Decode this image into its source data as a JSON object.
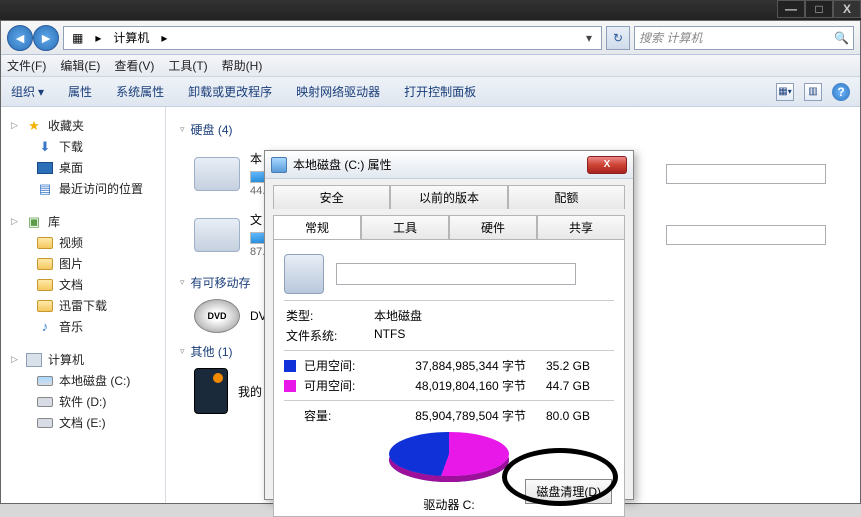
{
  "window_controls": {
    "min": "—",
    "max": "□",
    "close": "X"
  },
  "nav": {
    "back": "◄",
    "fwd": "►",
    "breadcrumb_icon": "▦",
    "breadcrumb": "计算机",
    "breadcrumb_arrow": "▸",
    "dropdown": "▾",
    "refresh": "↻",
    "search_placeholder": "搜索 计算机",
    "search_icon": "🔍"
  },
  "menubar": [
    "文件(F)",
    "编辑(E)",
    "查看(V)",
    "工具(T)",
    "帮助(H)"
  ],
  "toolbar": {
    "organize": "组织",
    "properties": "属性",
    "sys_properties": "系统属性",
    "uninstall": "卸载或更改程序",
    "map_drive": "映射网络驱动器",
    "control_panel": "打开控制面板",
    "help": "?"
  },
  "sidebar": {
    "favorites": {
      "label": "收藏夹",
      "items": [
        "下载",
        "桌面",
        "最近访问的位置"
      ]
    },
    "libraries": {
      "label": "库",
      "items": [
        "视频",
        "图片",
        "文档",
        "迅雷下载",
        "音乐"
      ]
    },
    "computer": {
      "label": "计算机",
      "items": [
        "本地磁盘 (C:)",
        "软件 (D:)",
        "文档 (E:)"
      ]
    }
  },
  "content": {
    "hdd_section": "硬盘 (4)",
    "removable_section": "有可移动存",
    "other_section": "其他 (1)",
    "drive1": {
      "name": "本",
      "sub": "44."
    },
    "drive2": {
      "name": "文",
      "sub": "87."
    },
    "dvd": "DV",
    "phone": "我的"
  },
  "dialog": {
    "title": "本地磁盘 (C:) 属性",
    "close": "X",
    "tabs_top": [
      "安全",
      "以前的版本",
      "配额"
    ],
    "tabs_bottom": [
      "常规",
      "工具",
      "硬件",
      "共享"
    ],
    "type_k": "类型:",
    "type_v": "本地磁盘",
    "fs_k": "文件系统:",
    "fs_v": "NTFS",
    "used_label": "已用空间:",
    "used_bytes": "37,884,985,344 字节",
    "used_gb": "35.2 GB",
    "free_label": "可用空间:",
    "free_bytes": "48,019,804,160 字节",
    "free_gb": "44.7 GB",
    "cap_label": "容量:",
    "cap_bytes": "85,904,789,504 字节",
    "cap_gb": "80.0 GB",
    "drive_label": "驱动器 C:",
    "cleanup": "磁盘清理(D)"
  },
  "chart_data": {
    "type": "pie",
    "title": "驱动器 C:",
    "series": [
      {
        "name": "已用空间",
        "value": 35.2,
        "unit": "GB",
        "bytes": 37884985344,
        "color": "#1030d8"
      },
      {
        "name": "可用空间",
        "value": 44.7,
        "unit": "GB",
        "bytes": 48019804160,
        "color": "#e818e8"
      }
    ],
    "total": {
      "label": "容量",
      "value": 80.0,
      "unit": "GB",
      "bytes": 85904789504
    }
  }
}
